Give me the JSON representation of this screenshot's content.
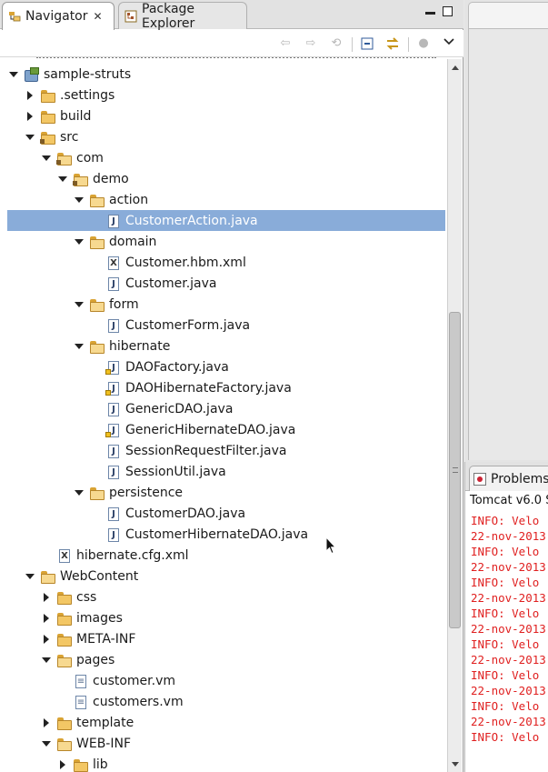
{
  "navigator": {
    "tabs": [
      {
        "label": "Navigator",
        "close": "✕"
      },
      {
        "label": "Package Explorer"
      }
    ],
    "tree": [
      {
        "label": "sample-struts",
        "depth": 0,
        "state": "open",
        "icon": "project-icon"
      },
      {
        "label": ".settings",
        "depth": 1,
        "state": "closed",
        "icon": "folder-icon"
      },
      {
        "label": "build",
        "depth": 1,
        "state": "closed",
        "icon": "folder-icon"
      },
      {
        "label": "src",
        "depth": 1,
        "state": "open",
        "icon": "source-folder-icon"
      },
      {
        "label": "com",
        "depth": 2,
        "state": "open",
        "icon": "package-folder-icon"
      },
      {
        "label": "demo",
        "depth": 3,
        "state": "open",
        "icon": "package-folder-icon"
      },
      {
        "label": "action",
        "depth": 4,
        "state": "open",
        "icon": "folder-open-icon"
      },
      {
        "label": "CustomerAction.java",
        "depth": 5,
        "state": "none",
        "icon": "java-file-icon",
        "selected": true
      },
      {
        "label": "domain",
        "depth": 4,
        "state": "open",
        "icon": "folder-open-icon"
      },
      {
        "label": "Customer.hbm.xml",
        "depth": 5,
        "state": "none",
        "icon": "xml-file-icon"
      },
      {
        "label": "Customer.java",
        "depth": 5,
        "state": "none",
        "icon": "java-file-icon"
      },
      {
        "label": "form",
        "depth": 4,
        "state": "open",
        "icon": "folder-open-icon"
      },
      {
        "label": "CustomerForm.java",
        "depth": 5,
        "state": "none",
        "icon": "java-file-icon"
      },
      {
        "label": "hibernate",
        "depth": 4,
        "state": "open",
        "icon": "folder-open-icon"
      },
      {
        "label": "DAOFactory.java",
        "depth": 5,
        "state": "none",
        "icon": "java-file-warning-icon"
      },
      {
        "label": "DAOHibernateFactory.java",
        "depth": 5,
        "state": "none",
        "icon": "java-file-warning-icon"
      },
      {
        "label": "GenericDAO.java",
        "depth": 5,
        "state": "none",
        "icon": "java-file-icon"
      },
      {
        "label": "GenericHibernateDAO.java",
        "depth": 5,
        "state": "none",
        "icon": "java-file-warning-icon"
      },
      {
        "label": "SessionRequestFilter.java",
        "depth": 5,
        "state": "none",
        "icon": "java-file-icon"
      },
      {
        "label": "SessionUtil.java",
        "depth": 5,
        "state": "none",
        "icon": "java-file-icon"
      },
      {
        "label": "persistence",
        "depth": 4,
        "state": "open",
        "icon": "folder-open-icon"
      },
      {
        "label": "CustomerDAO.java",
        "depth": 5,
        "state": "none",
        "icon": "java-file-icon"
      },
      {
        "label": "CustomerHibernateDAO.java",
        "depth": 5,
        "state": "none",
        "icon": "java-file-icon"
      },
      {
        "label": "hibernate.cfg.xml",
        "depth": 2,
        "state": "none",
        "icon": "xml-file-icon"
      },
      {
        "label": "WebContent",
        "depth": 1,
        "state": "open",
        "icon": "folder-open-icon"
      },
      {
        "label": "css",
        "depth": 2,
        "state": "closed",
        "icon": "folder-icon"
      },
      {
        "label": "images",
        "depth": 2,
        "state": "closed",
        "icon": "folder-icon"
      },
      {
        "label": "META-INF",
        "depth": 2,
        "state": "closed",
        "icon": "folder-icon"
      },
      {
        "label": "pages",
        "depth": 2,
        "state": "open",
        "icon": "folder-open-icon"
      },
      {
        "label": "customer.vm",
        "depth": 3,
        "state": "none",
        "icon": "vm-file-icon"
      },
      {
        "label": "customers.vm",
        "depth": 3,
        "state": "none",
        "icon": "vm-file-icon"
      },
      {
        "label": "template",
        "depth": 2,
        "state": "closed",
        "icon": "folder-icon"
      },
      {
        "label": "WEB-INF",
        "depth": 2,
        "state": "open",
        "icon": "folder-open-icon"
      },
      {
        "label": "lib",
        "depth": 3,
        "state": "closed",
        "icon": "folder-icon"
      }
    ]
  },
  "console": {
    "tab_label": "Problems",
    "title": "Tomcat v6.0 S",
    "lines": [
      "INFO:  Velo",
      "22-nov-2013",
      "INFO:  Velo",
      "22-nov-2013",
      "INFO:  Velo",
      "22-nov-2013",
      "INFO:  Velo",
      "22-nov-2013",
      "INFO:  Velo",
      "22-nov-2013",
      "INFO:  Velo",
      "22-nov-2013",
      "INFO:  Velo",
      "22-nov-2013",
      "INFO:  Velo"
    ]
  },
  "colors": {
    "selection": "#89acd9",
    "console_text": "#e02020"
  }
}
